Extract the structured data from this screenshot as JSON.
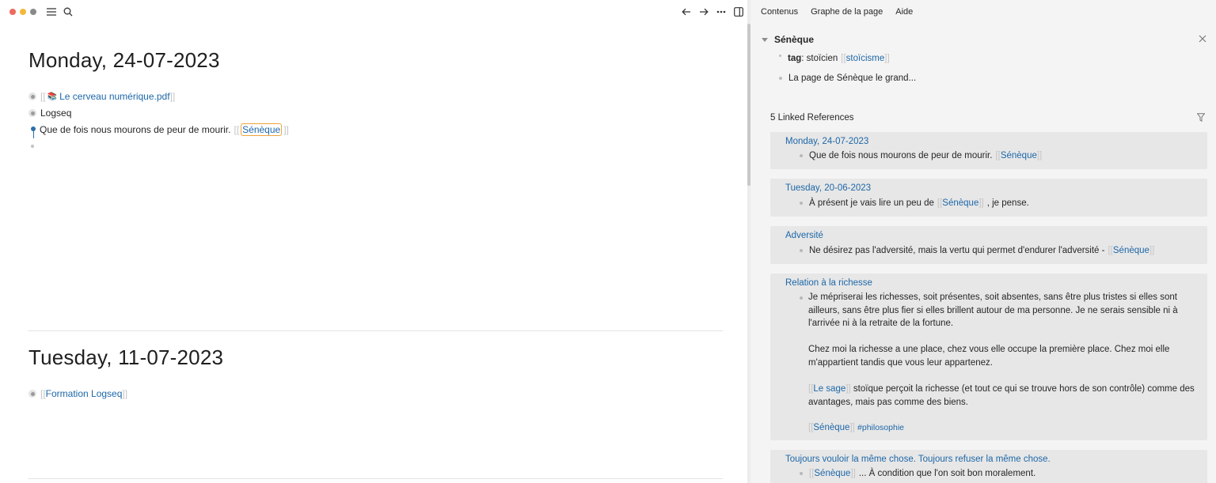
{
  "topbar": {
    "window_controls": [
      "close",
      "minimize",
      "zoom"
    ],
    "icons": [
      "menu-icon",
      "search-icon",
      "arrow-left-icon",
      "arrow-right-icon",
      "more-icon",
      "sidebar-toggle-icon"
    ]
  },
  "journals": [
    {
      "title": "Monday, 24-07-2023",
      "blocks": [
        {
          "open": "[[",
          "icon": "📚",
          "link": "Le cerveau numérique.pdf",
          "close": "]]"
        },
        {
          "text": "Logseq"
        },
        {
          "text": "Que de fois nous mourons de peur de mourir.",
          "open": "[[",
          "link": "Sénèque",
          "close": "]]"
        }
      ]
    },
    {
      "title": "Tuesday, 11-07-2023",
      "blocks": [
        {
          "open": "[[",
          "link": "Formation Logseq",
          "close": "]]"
        }
      ]
    }
  ],
  "sidebar": {
    "tabs": [
      "Contenus",
      "Graphe de la page",
      "Aide"
    ],
    "page": {
      "title": "Sénèque",
      "properties": {
        "key": "tag",
        "sep": ": ",
        "value": "stoïcien",
        "open": "[[",
        "link": "stoïcisme",
        "close": "]]"
      },
      "content": "La page de Sénèque le grand..."
    },
    "linked_refs_title": "5 Linked References",
    "references": [
      {
        "title": "Monday, 24-07-2023",
        "text": "Que de fois nous mourons de peur de mourir.",
        "open": "[[",
        "link": "Sénèque",
        "close": "]]"
      },
      {
        "title": "Tuesday, 20-06-2023",
        "text": "À présent je vais lire un peu de",
        "open": "[[",
        "link": "Sénèque",
        "close": "]]",
        "suffix": ", je pense."
      },
      {
        "title": "Adversité",
        "text": "Ne désirez pas l'adversité, mais la vertu qui permet d'endurer l'adversité -",
        "open": "[[",
        "link": "Sénèque",
        "close": "]]"
      },
      {
        "title": "Relation à la richesse",
        "p1": "Je mépriserai les richesses, soit présentes, soit absentes, sans être plus tristes si elles sont ailleurs, sans être plus fier si elles brillent autour de ma personne. Je ne serais sensible ni à l'arrivée ni à la retraite de la fortune.",
        "p2": "Chez moi la richesse a une place, chez vous elle occupe la première place. Chez moi elle m'appartient tandis que vous leur appartenez.",
        "p3_open": "[[",
        "p3_link": "Le sage",
        "p3_close": "]]",
        "p3_text": "stoïque perçoit la richesse (et tout ce qui se trouve hors de son contrôle) comme des avantages, mais pas comme des biens.",
        "p4_open": "[[",
        "p4_link": "Sénèque",
        "p4_close": "]]",
        "p4_tag": "#philosophie"
      },
      {
        "title": "Toujours vouloir la même chose. Toujours refuser la même chose.",
        "open": "[[",
        "link": "Sénèque",
        "close": "]]",
        "text": "... À condition que l'on soit bon moralement."
      }
    ]
  },
  "colors": {
    "link": "#1d67a8",
    "highlight_border": "#f0a23a",
    "sidebar_bg": "#f4f4f4",
    "card_bg": "#e7e7e7"
  }
}
